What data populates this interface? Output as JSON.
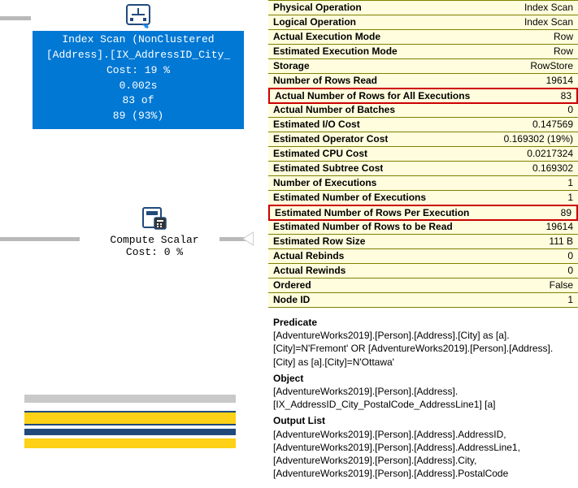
{
  "plan": {
    "index_scan": {
      "title": "Index Scan (NonClustered",
      "object": "[Address].[IX_AddressID_City_",
      "cost": "Cost: 19 %",
      "time": "0.002s",
      "rows_actual": "83 of",
      "rows_est": "89 (93%)"
    },
    "compute_scalar": {
      "title": "Compute Scalar",
      "cost": "Cost: 0 %"
    }
  },
  "props": [
    {
      "k": "Physical Operation",
      "v": "Index Scan",
      "bold": true
    },
    {
      "k": "Logical Operation",
      "v": "Index Scan",
      "bold": true
    },
    {
      "k": "Actual Execution Mode",
      "v": "Row",
      "bold": true
    },
    {
      "k": "Estimated Execution Mode",
      "v": "Row",
      "bold": true
    },
    {
      "k": "Storage",
      "v": "RowStore",
      "bold": true
    },
    {
      "k": "Number of Rows Read",
      "v": "19614",
      "bold": true
    },
    {
      "k": "Actual Number of Rows for All Executions",
      "v": "83",
      "bold": true,
      "hl": true
    },
    {
      "k": "Actual Number of Batches",
      "v": "0",
      "bold": true
    },
    {
      "k": "Estimated I/O Cost",
      "v": "0.147569",
      "bold": true
    },
    {
      "k": "Estimated Operator Cost",
      "v": "0.169302 (19%)",
      "bold": true
    },
    {
      "k": "Estimated CPU Cost",
      "v": "0.0217324",
      "bold": true
    },
    {
      "k": "Estimated Subtree Cost",
      "v": "0.169302",
      "bold": true
    },
    {
      "k": "Number of Executions",
      "v": "1",
      "bold": true
    },
    {
      "k": "Estimated Number of Executions",
      "v": "1",
      "bold": true
    },
    {
      "k": "Estimated Number of Rows Per Execution",
      "v": "89",
      "bold": true,
      "hl": true
    },
    {
      "k": "Estimated Number of Rows to be Read",
      "v": "19614",
      "bold": true
    },
    {
      "k": "Estimated Row Size",
      "v": "111 B",
      "bold": true
    },
    {
      "k": "Actual Rebinds",
      "v": "0",
      "bold": true
    },
    {
      "k": "Actual Rewinds",
      "v": "0",
      "bold": true
    },
    {
      "k": "Ordered",
      "v": "False",
      "bold": true
    },
    {
      "k": "Node ID",
      "v": "1",
      "bold": true
    }
  ],
  "body": {
    "predicate_label": "Predicate",
    "predicate_text": "[AdventureWorks2019].[Person].[Address].[City] as [a].[City]=N'Fremont' OR [AdventureWorks2019].[Person].[Address].[City] as [a].[City]=N'Ottawa'",
    "object_label": "Object",
    "object_text": "[AdventureWorks2019].[Person].[Address].[IX_AddressID_City_PostalCode_AddressLine1] [a]",
    "output_label": "Output List",
    "output_text": "[AdventureWorks2019].[Person].[Address].AddressID, [AdventureWorks2019].[Person].[Address].AddressLine1, [AdventureWorks2019].[Person].[Address].City, [AdventureWorks2019].[Person].[Address].PostalCode"
  }
}
